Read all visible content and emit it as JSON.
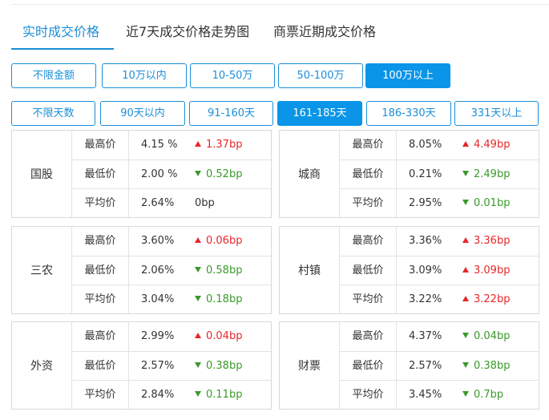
{
  "tabs": [
    {
      "label": "实时成交价格",
      "active": true
    },
    {
      "label": "近7天成交价格走势图",
      "active": false
    },
    {
      "label": "商票近期成交价格",
      "active": false
    }
  ],
  "amount_filters": [
    {
      "label": "不限金额",
      "active": false
    },
    {
      "label": "10万以内",
      "active": false
    },
    {
      "label": "10-50万",
      "active": false
    },
    {
      "label": "50-100万",
      "active": false
    },
    {
      "label": "100万以上",
      "active": true
    }
  ],
  "days_filters": [
    {
      "label": "不限天数",
      "active": false
    },
    {
      "label": "90天以内",
      "active": false
    },
    {
      "label": "91-160天",
      "active": false
    },
    {
      "label": "161-185天",
      "active": true
    },
    {
      "label": "186-330天",
      "active": false
    },
    {
      "label": "331天以上",
      "active": false
    }
  ],
  "colors": {
    "accent": "#0a95e8",
    "up": "#e8262a",
    "down": "#3a9a2a"
  },
  "cards": [
    {
      "category": "国股",
      "rows": [
        {
          "label": "最高价",
          "rate": "4.15 %",
          "change": "1.37bp",
          "direction": "up"
        },
        {
          "label": "最低价",
          "rate": "2.00 %",
          "change": "0.52bp",
          "direction": "down"
        },
        {
          "label": "平均价",
          "rate": "2.64%",
          "change": "0bp",
          "direction": "flat"
        }
      ]
    },
    {
      "category": "城商",
      "rows": [
        {
          "label": "最高价",
          "rate": "8.05%",
          "change": "4.49bp",
          "direction": "up"
        },
        {
          "label": "最低价",
          "rate": "0.21%",
          "change": "2.49bp",
          "direction": "down"
        },
        {
          "label": "平均价",
          "rate": "2.95%",
          "change": "0.01bp",
          "direction": "down"
        }
      ]
    },
    {
      "category": "三农",
      "rows": [
        {
          "label": "最高价",
          "rate": "3.60%",
          "change": "0.06bp",
          "direction": "up"
        },
        {
          "label": "最低价",
          "rate": "2.06%",
          "change": "0.58bp",
          "direction": "down"
        },
        {
          "label": "平均价",
          "rate": "3.04%",
          "change": "0.18bp",
          "direction": "down"
        }
      ]
    },
    {
      "category": "村镇",
      "rows": [
        {
          "label": "最高价",
          "rate": "3.36%",
          "change": "3.36bp",
          "direction": "up"
        },
        {
          "label": "最低价",
          "rate": "3.09%",
          "change": "3.09bp",
          "direction": "up"
        },
        {
          "label": "平均价",
          "rate": "3.22%",
          "change": "3.22bp",
          "direction": "up"
        }
      ]
    },
    {
      "category": "外资",
      "rows": [
        {
          "label": "最高价",
          "rate": "2.99%",
          "change": "0.04bp",
          "direction": "up"
        },
        {
          "label": "最低价",
          "rate": "2.57%",
          "change": "0.38bp",
          "direction": "down"
        },
        {
          "label": "平均价",
          "rate": "2.84%",
          "change": "0.11bp",
          "direction": "down"
        }
      ]
    },
    {
      "category": "财票",
      "rows": [
        {
          "label": "最高价",
          "rate": "4.37%",
          "change": "0.04bp",
          "direction": "down"
        },
        {
          "label": "最低价",
          "rate": "2.57%",
          "change": "0.38bp",
          "direction": "down"
        },
        {
          "label": "平均价",
          "rate": "3.45%",
          "change": "0.7bp",
          "direction": "down"
        }
      ]
    }
  ]
}
